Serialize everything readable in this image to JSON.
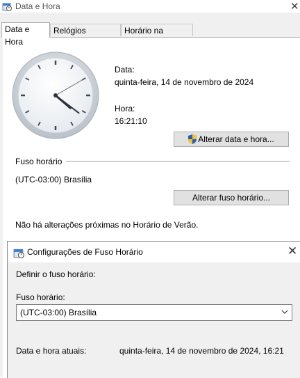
{
  "back_window": {
    "title": "Data e Hora",
    "tabs": [
      {
        "label": "Data e Hora"
      },
      {
        "label": "Relógios Adicionais"
      },
      {
        "label": "Horário na Internet"
      }
    ],
    "date_label": "Data:",
    "date_value": "quinta-feira, 14 de novembro de 2024",
    "time_label": "Hora:",
    "time_value": "16:21:10",
    "change_datetime_button": "Alterar data e hora...",
    "timezone_section_label": "Fuso horário",
    "timezone_value": "(UTC-03:00) Brasília",
    "change_timezone_button": "Alterar fuso horário...",
    "dst_notice": "Não há alterações próximas no Horário de Verão."
  },
  "front_dialog": {
    "title": "Configurações de Fuso Horário",
    "set_timezone_label": "Definir o fuso horário:",
    "timezone_label": "Fuso horário:",
    "timezone_selected": "(UTC-03:00) Brasília",
    "current_datetime_label": "Data e hora atuais:",
    "current_datetime_value": "quinta-feira, 14 de novembro de 2024, 16:21"
  },
  "clock": {
    "hour": 4,
    "minute": 21,
    "second": 10
  },
  "icons": {
    "app_icon": "datetime-app-icon",
    "shield": "uac-shield-icon",
    "close": "close-icon",
    "chevron": "chevron-down-icon"
  }
}
